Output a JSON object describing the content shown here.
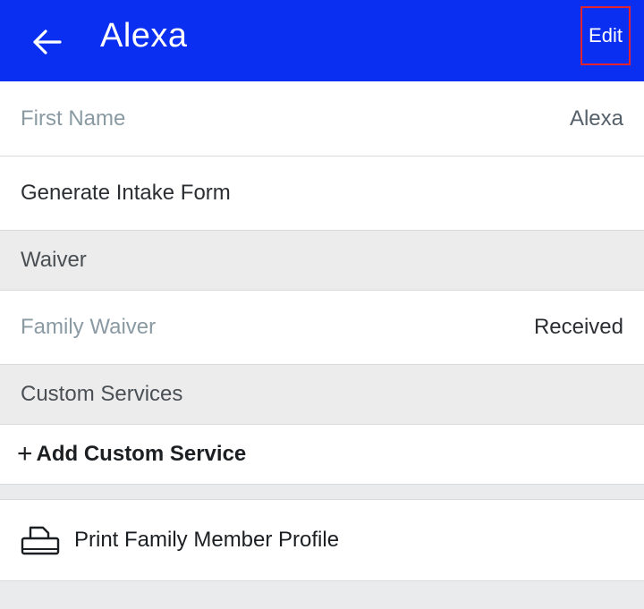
{
  "header": {
    "title": "Alexa",
    "edit_label": "Edit",
    "back_icon": "arrow-left-icon",
    "background_color": "#0a2ff0",
    "highlight_color": "#e3262d"
  },
  "fields": {
    "first_name_label": "First Name",
    "first_name_value": "Alexa",
    "intake_form_label": "Generate Intake Form"
  },
  "waiver": {
    "section_title": "Waiver",
    "family_waiver_label": "Family Waiver",
    "family_waiver_status": "Received"
  },
  "custom_services": {
    "section_title": "Custom Services",
    "add_label": "Add Custom Service",
    "add_icon": "plus-icon"
  },
  "actions": {
    "print_label": "Print Family Member Profile",
    "print_icon": "printer-icon"
  }
}
